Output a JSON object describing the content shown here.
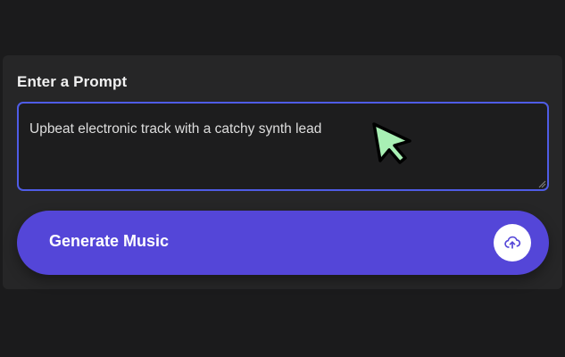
{
  "prompt_card": {
    "label": "Enter a Prompt",
    "prompt_value": "Upbeat electronic track with a catchy synth lead",
    "focus_color": "#4f5ce6"
  },
  "generate": {
    "label": "Generate Music",
    "button_color": "#5446d8",
    "icon": "cloud-upload-icon"
  },
  "cursor": {
    "icon": "mouse-pointer-icon",
    "color": "#a8f0b4"
  }
}
